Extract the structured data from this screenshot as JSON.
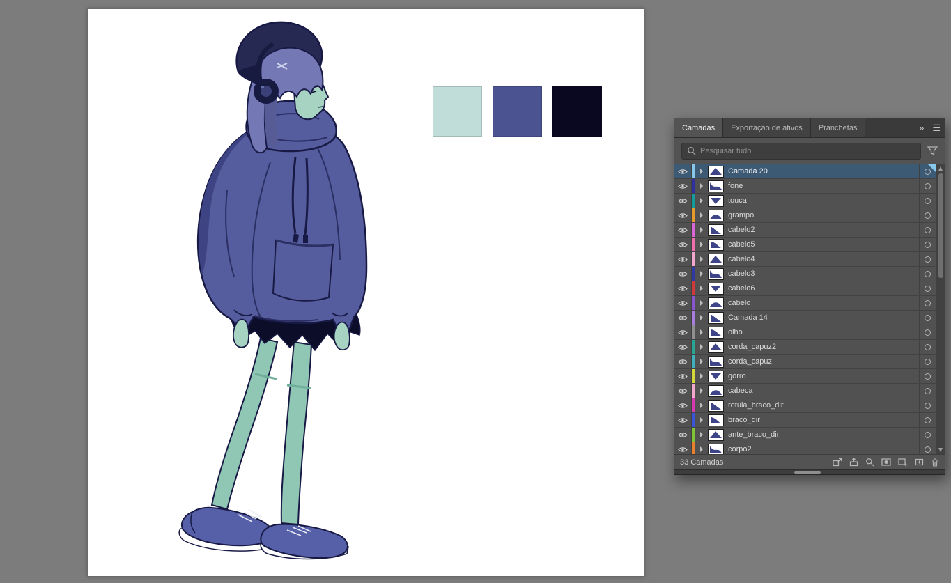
{
  "app": {
    "background": "#7c7c7c"
  },
  "canvas": {
    "swatches": [
      {
        "name": "swatch-light-teal",
        "color": "#c1ddd9"
      },
      {
        "name": "swatch-blue-purple",
        "color": "#4b5391"
      },
      {
        "name": "swatch-dark-navy",
        "color": "#0a0721"
      }
    ]
  },
  "illustration": {
    "palette": {
      "outline": "#181a45",
      "hoodie": "#565d9f",
      "hoodieShadow": "#3e4483",
      "hoodieDark": "#2b2f63",
      "hair": "#7479b6",
      "hairShadow": "#585c96",
      "beanie": "#262a52",
      "beanieDark": "#181b40",
      "skin": "#a7d3c3",
      "skinShadow": "#6fae9b",
      "skirt": "#0c0d28",
      "stocking": "#8fc6b4",
      "shoe": "#5560a8",
      "lace": "#e8eaf4",
      "sole": "#ffffff"
    }
  },
  "panel": {
    "tabs": [
      {
        "label": "Camadas",
        "active": true
      },
      {
        "label": "Exportação de ativos",
        "active": false
      },
      {
        "label": "Pranchetas",
        "active": false
      }
    ],
    "overflow_glyph": "»",
    "menu_glyph": "☰",
    "search": {
      "placeholder": "Pesquisar tudo"
    },
    "layers": [
      {
        "name": "Camada 20",
        "color": "#86c7ea",
        "selected": true
      },
      {
        "name": "fone",
        "color": "#2f2fa2",
        "selected": false
      },
      {
        "name": "touca",
        "color": "#159a9a",
        "selected": false
      },
      {
        "name": "grampo",
        "color": "#e79a2e",
        "selected": false
      },
      {
        "name": "cabelo2",
        "color": "#d966d9",
        "selected": false
      },
      {
        "name": "cabelo5",
        "color": "#ef6fae",
        "selected": false
      },
      {
        "name": "cabelo4",
        "color": "#f2a8cc",
        "selected": false
      },
      {
        "name": "cabelo3",
        "color": "#2f3ba2",
        "selected": false
      },
      {
        "name": "cabelo6",
        "color": "#cf3a3a",
        "selected": false
      },
      {
        "name": "cabelo",
        "color": "#8a55cc",
        "selected": false
      },
      {
        "name": "Camada 14",
        "color": "#a77ddd",
        "selected": false
      },
      {
        "name": "olho",
        "color": "#8f8f8f",
        "selected": false
      },
      {
        "name": "corda_capuz2",
        "color": "#2aa593",
        "selected": false
      },
      {
        "name": "corda_capuz",
        "color": "#3fb0bd",
        "selected": false
      },
      {
        "name": "gorro",
        "color": "#d6d63e",
        "selected": false
      },
      {
        "name": "cabeca",
        "color": "#f2a8cc",
        "selected": false
      },
      {
        "name": "rotula_braco_dir",
        "color": "#d63ab0",
        "selected": false
      },
      {
        "name": "braco_dir",
        "color": "#3a55d6",
        "selected": false
      },
      {
        "name": "ante_braco_dir",
        "color": "#83c436",
        "selected": false
      },
      {
        "name": "corpo2",
        "color": "#e8802e",
        "selected": false
      }
    ],
    "status": "33 Camadas"
  }
}
